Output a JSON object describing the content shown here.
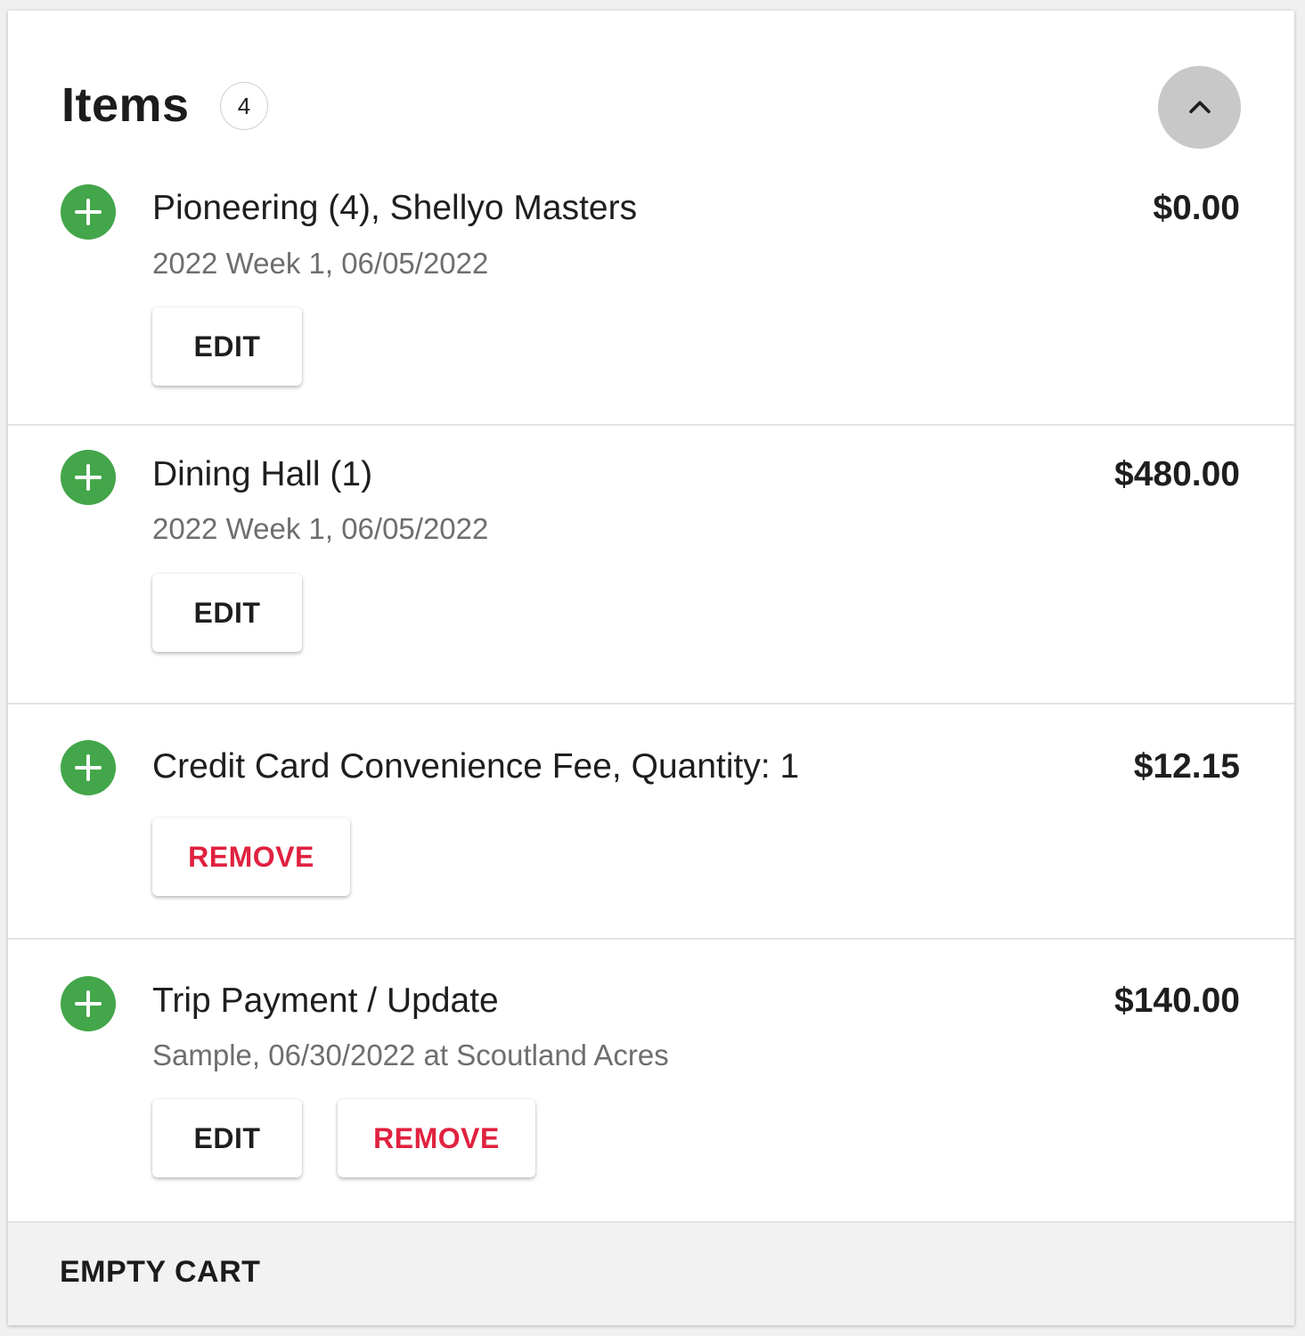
{
  "header": {
    "title": "Items",
    "count": "4"
  },
  "items": [
    {
      "name": "Pioneering (4), Shellyo Masters",
      "subtitle": "2022 Week 1, 06/05/2022",
      "price": "$0.00",
      "edit_label": "EDIT"
    },
    {
      "name": "Dining Hall (1)",
      "subtitle": "2022 Week 1, 06/05/2022",
      "price": "$480.00",
      "edit_label": "EDIT"
    },
    {
      "name": "Credit Card Convenience Fee, Quantity: 1",
      "price": "$12.15",
      "remove_label": "REMOVE"
    },
    {
      "name": "Trip Payment / Update",
      "subtitle": "Sample, 06/30/2022 at Scoutland Acres",
      "price": "$140.00",
      "edit_label": "EDIT",
      "remove_label": "REMOVE"
    }
  ],
  "footer": {
    "empty_cart_label": "EMPTY CART"
  },
  "colors": {
    "plus_icon": "#43a64a",
    "remove_text": "#e0213f",
    "collapse_button": "#c8c8c8"
  },
  "icons": {
    "item_icon": "plus-circle-icon",
    "collapse_icon": "chevron-up-icon"
  }
}
